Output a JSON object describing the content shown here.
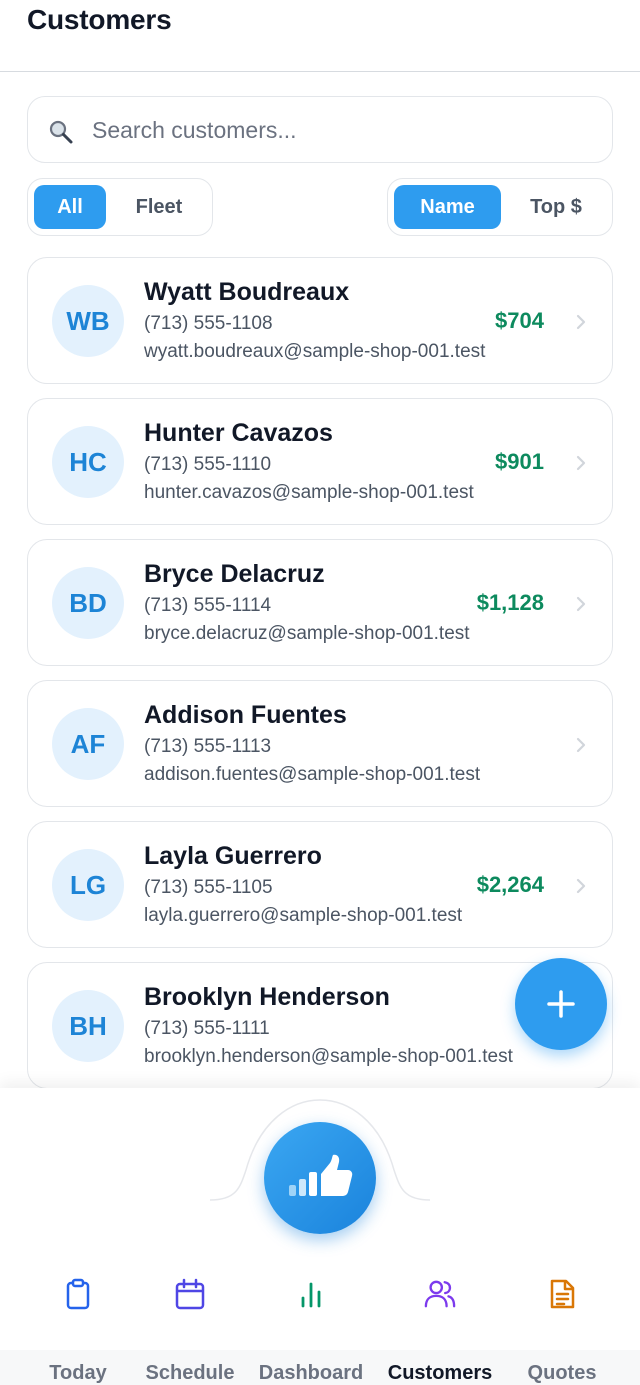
{
  "header": {
    "title": "Customers"
  },
  "search": {
    "placeholder": "Search customers..."
  },
  "filter": {
    "options": [
      "All",
      "Fleet"
    ],
    "selected": "All"
  },
  "sort": {
    "options": [
      "Name",
      "Top $"
    ],
    "selected": "Name"
  },
  "customers": [
    {
      "initials": "WB",
      "name": "Wyatt Boudreaux",
      "phone": "(713) 555-1108",
      "email": "wyatt.boudreaux@sample-shop-001.test",
      "amount": "$704"
    },
    {
      "initials": "HC",
      "name": "Hunter Cavazos",
      "phone": "(713) 555-1110",
      "email": "hunter.cavazos@sample-shop-001.test",
      "amount": "$901"
    },
    {
      "initials": "BD",
      "name": "Bryce Delacruz",
      "phone": "(713) 555-1114",
      "email": "bryce.delacruz@sample-shop-001.test",
      "amount": "$1,128"
    },
    {
      "initials": "AF",
      "name": "Addison Fuentes",
      "phone": "(713) 555-1113",
      "email": "addison.fuentes@sample-shop-001.test",
      "amount": ""
    },
    {
      "initials": "LG",
      "name": "Layla Guerrero",
      "phone": "(713) 555-1105",
      "email": "layla.guerrero@sample-shop-001.test",
      "amount": "$2,264"
    },
    {
      "initials": "BH",
      "name": "Brooklyn Henderson",
      "phone": "(713) 555-1111",
      "email": "brooklyn.henderson@sample-shop-001.test",
      "amount": ""
    }
  ],
  "fab": {
    "icon": "plus-icon"
  },
  "center_button": {
    "icon": "thumbs-up-chart-icon"
  },
  "tabs": [
    {
      "label": "Today",
      "icon": "clipboard-icon",
      "color": "#2563eb"
    },
    {
      "label": "Schedule",
      "icon": "calendar-icon",
      "color": "#4f46e5"
    },
    {
      "label": "Dashboard",
      "icon": "bar-chart-icon",
      "color": "#059669"
    },
    {
      "label": "Customers",
      "icon": "users-icon",
      "color": "#7c3aed"
    },
    {
      "label": "Quotes",
      "icon": "document-icon",
      "color": "#d97706"
    }
  ],
  "active_tab": "Customers",
  "colors": {
    "accent": "#2e9cef",
    "amount": "#0d8a5e",
    "avatar_bg": "#e3f1fd",
    "avatar_text": "#1d84d6"
  }
}
